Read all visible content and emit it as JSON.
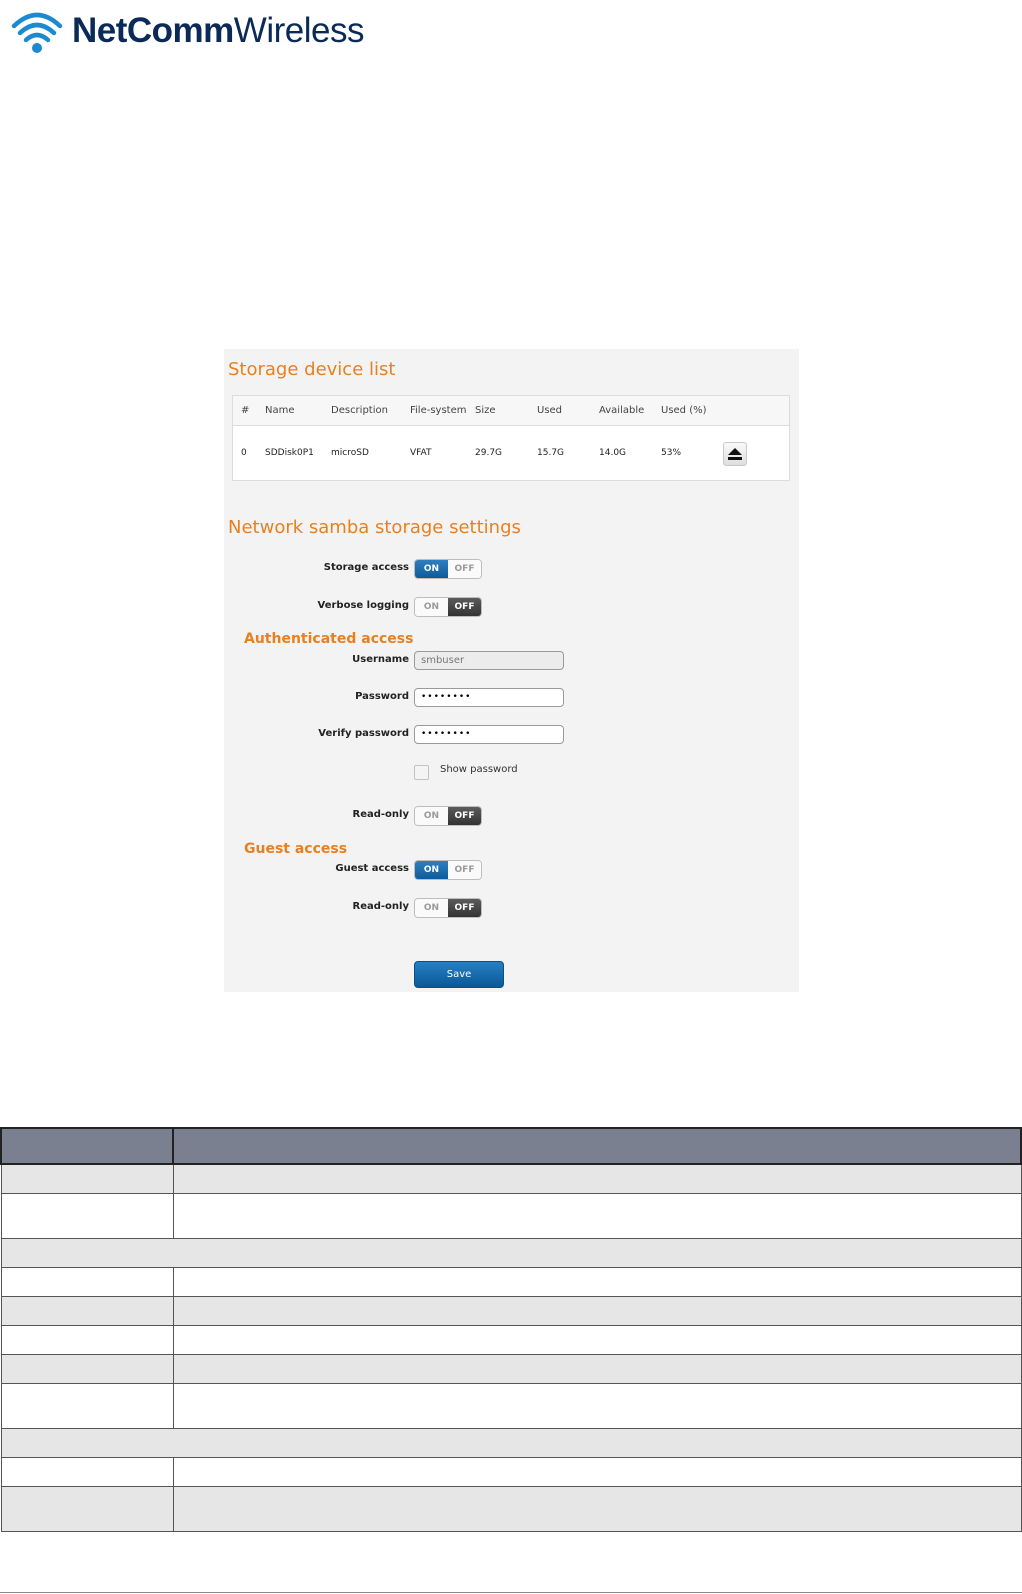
{
  "logo": {
    "brand_bold": "NetComm",
    "brand_light": "Wireless",
    "icon": "wifi-signal-logo-icon",
    "color": "#0b2a57"
  },
  "panel": {
    "storage_list_title": "Storage device list",
    "columns": [
      "#",
      "Name",
      "Description",
      "File-system",
      "Size",
      "Used",
      "Available",
      "Used (%)"
    ],
    "devices": [
      {
        "index": "0",
        "name": "SDDisk0P1",
        "description": "microSD",
        "filesystem": "VFAT",
        "size": "29.7G",
        "used": "15.7G",
        "available": "14.0G",
        "used_pct": "53%",
        "action_icon": "eject-icon"
      }
    ],
    "samba_title": "Network samba storage settings",
    "storage_access": {
      "label": "Storage access",
      "on": "ON",
      "off": "OFF",
      "value": "ON"
    },
    "verbose_logging": {
      "label": "Verbose logging",
      "on": "ON",
      "off": "OFF",
      "value": "OFF"
    },
    "auth_title": "Authenticated access",
    "username": {
      "label": "Username",
      "value": "smbuser"
    },
    "password": {
      "label": "Password",
      "value": "••••••••"
    },
    "verify_password": {
      "label": "Verify password",
      "value": "••••••••"
    },
    "show_password": {
      "label": "Show password",
      "checked": false
    },
    "auth_readonly": {
      "label": "Read-only",
      "on": "ON",
      "off": "OFF",
      "value": "OFF"
    },
    "guest_title": "Guest access",
    "guest_access": {
      "label": "Guest access",
      "on": "ON",
      "off": "OFF",
      "value": "ON"
    },
    "guest_readonly": {
      "label": "Read-only",
      "on": "ON",
      "off": "OFF",
      "value": "OFF"
    },
    "save_label": "Save",
    "accent_color": "#e8801e",
    "button_color": "#0e5b9b"
  }
}
